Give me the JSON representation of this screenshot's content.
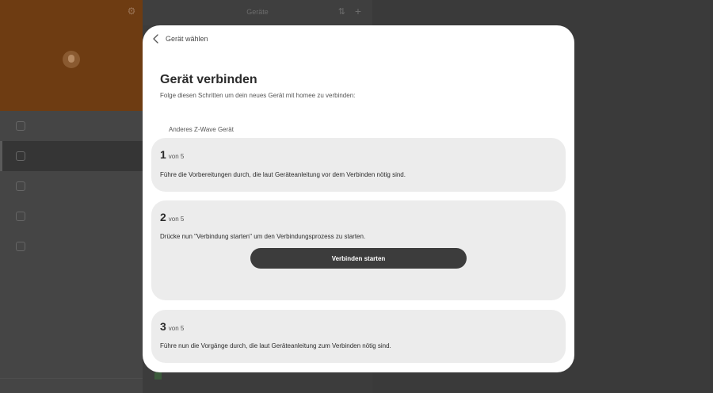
{
  "background": {
    "main_title": "Geräte"
  },
  "modal": {
    "back_label": "Gerät wählen",
    "title": "Gerät verbinden",
    "subtitle": "Folge diesen Schritten um dein neues Gerät mit homee zu verbinden:",
    "device_name": "Anderes Z-Wave Gerät",
    "steps": [
      {
        "number": "1",
        "of_label": "von 5",
        "text": "Führe die Vorbereitungen durch, die laut Geräteanleitung vor dem Verbinden nötig sind."
      },
      {
        "number": "2",
        "of_label": "von 5",
        "text": "Drücke nun \"Verbindung starten\" um den Verbindungsprozess zu starten.",
        "button_label": "Verbinden starten"
      },
      {
        "number": "3",
        "of_label": "von 5",
        "text": "Führe nun die Vorgänge durch, die laut Geräteanleitung zum Verbinden nötig sind."
      }
    ]
  },
  "icons": {
    "back": "chevron-left-icon",
    "settings": "gear-icon",
    "sort": "sort-icon",
    "add": "plus-icon"
  },
  "colors": {
    "modal_bg": "#ffffff",
    "step_bg": "#ececec",
    "button_bg": "#3c3c3c",
    "sidebar_header": "#6e3c12"
  }
}
